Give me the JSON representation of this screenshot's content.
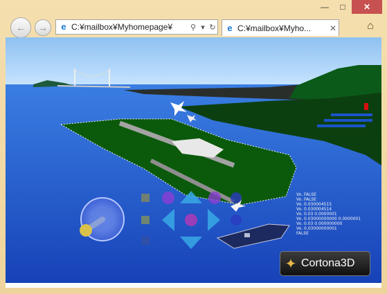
{
  "browser": {
    "address": "C:¥mailbox¥Myhomepage¥",
    "tab_title": "C:¥mailbox¥Myho...",
    "titlebar_buttons": {
      "minimize": "—",
      "maximize": "□",
      "close": "✕"
    }
  },
  "viewer": {
    "logo_text": "Cortona3D",
    "hud_lines": [
      "Vo. FALSE",
      "Vo. FALSE",
      "Vo. 0.030004515",
      "Vo. 0.030004514",
      "Vo. 0.03 0.0000001",
      "Vo. 0.03000000000 0.0000001",
      "Vo. 0.03 0.000000000",
      "Vo. 0.03000000001",
      "FALSE"
    ]
  },
  "colors": {
    "sky_top": "#8ec1f0",
    "sea": "#1b54c9",
    "island": "#0b5a0b",
    "close": "#c75050",
    "frame": "#f3dca9"
  },
  "icons": {
    "back": "back-arrow-icon",
    "forward": "forward-arrow-icon",
    "ie": "internet-explorer-icon",
    "search": "search-icon",
    "dropdown": "chevron-down-icon",
    "refresh": "refresh-icon",
    "close_tab": "close-icon",
    "home": "home-icon"
  }
}
